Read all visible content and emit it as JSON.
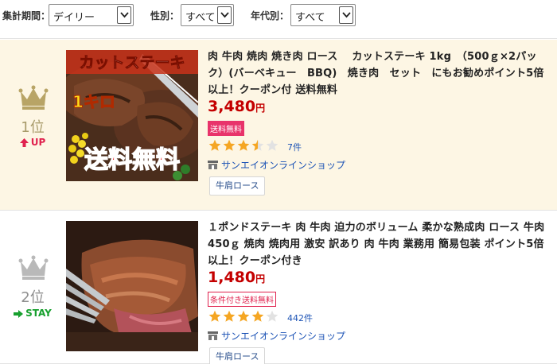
{
  "filters": {
    "period": {
      "label": "集計期間：",
      "value": "デイリー"
    },
    "gender": {
      "label": "性別：",
      "value": "すべて"
    },
    "age": {
      "label": "年代別：",
      "value": "すべて"
    }
  },
  "items": [
    {
      "rank": "1位",
      "movement": "UP",
      "image_text": {
        "top": "カットステーキ",
        "middle": "1キロ",
        "bottom": "送料無料"
      },
      "title": "肉 牛肉 焼肉 焼き肉 ロース　 カットステーキ 1kg　（500ｇ×2パック）(バーベキュー　BBQ)　焼き肉　セット　にもお勧めポイント5倍以上！クーポン付 送料無料",
      "price": "3,480",
      "price_unit": "円",
      "shipping_tag": "送料無料",
      "rating": 3.5,
      "review_count": "7件",
      "shop": "サンエイオンラインショップ",
      "category": "牛肩ロース"
    },
    {
      "rank": "2位",
      "movement": "STAY",
      "title": "１ポンドステーキ 肉 牛肉 迫力のボリューム 柔かな熟成肉 ロース 牛肉 450ｇ 焼肉 焼肉用 激安 訳あり 肉 牛肉 業務用 簡易包装 ポイント5倍以上！クーポン付き",
      "price": "1,480",
      "price_unit": "円",
      "shipping_tag": "条件付き送料無料",
      "rating": 4,
      "review_count": "442件",
      "shop": "サンエイオンラインショップ",
      "category": "牛肩ロース"
    }
  ],
  "colors": {
    "price": "#c40000",
    "link": "#1b52b5",
    "up": "#e0224e",
    "stay": "#17a02e",
    "crown": "#b8a466",
    "star": "#f5a623",
    "tag_pink": "#e8336b",
    "item1_bg": "#fdf6e4"
  },
  "icons": {
    "select_arrow": "chevron-down-icon",
    "crown": "crown-icon",
    "up": "up-arrow-icon",
    "stay": "right-arrow-icon",
    "shop": "shop-icon",
    "star": "star-icon"
  }
}
